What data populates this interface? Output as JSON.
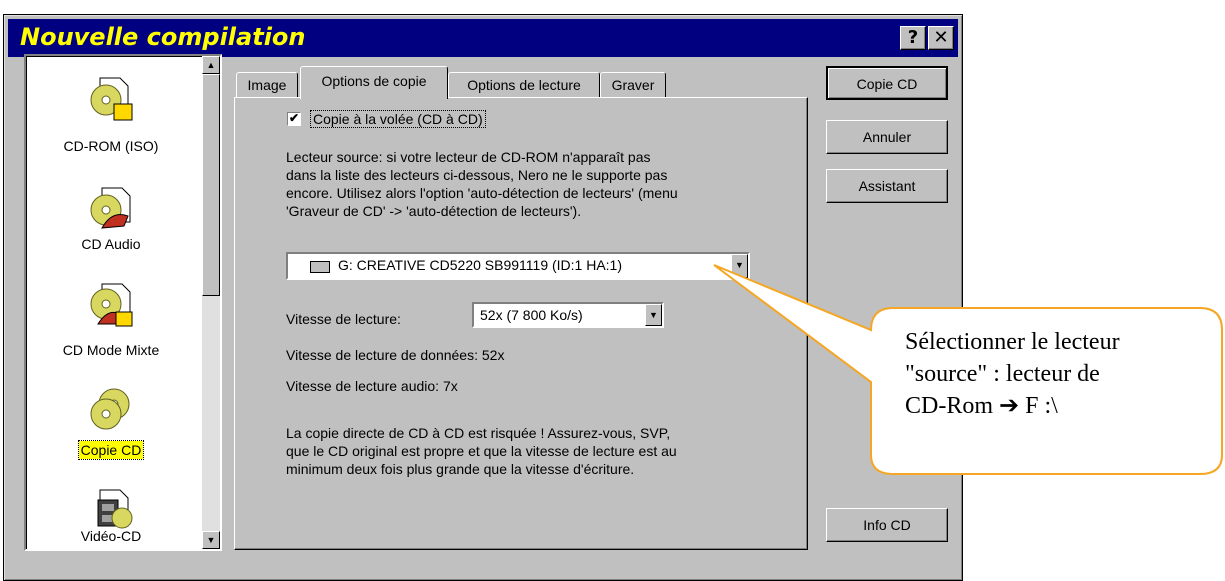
{
  "window": {
    "title": "Nouvelle compilation",
    "help_label": "?",
    "close_label": "✕"
  },
  "categories": [
    {
      "label": "CD-ROM (ISO)",
      "icon": "cd-rom-iso-icon"
    },
    {
      "label": "CD Audio",
      "icon": "cd-audio-icon"
    },
    {
      "label": "CD Mode Mixte",
      "icon": "cd-mixed-mode-icon"
    },
    {
      "label": "Copie CD",
      "icon": "copy-cd-icon",
      "selected": true
    },
    {
      "label": "Vidéo-CD",
      "icon": "video-cd-icon"
    }
  ],
  "tabs": [
    "Image",
    "Options de copie",
    "Options de lecture",
    "Graver"
  ],
  "active_tab": "Options de copie",
  "copy_options": {
    "on_the_fly_checked": true,
    "on_the_fly_check": "✔",
    "on_the_fly_label": "Copie à la volée (CD à CD)",
    "source_info_lines": [
      "Lecteur source: si votre lecteur de CD-ROM n'apparaît pas",
      "dans la liste des lecteurs ci-dessous, Nero ne le supporte pas",
      "encore. Utilisez alors l'option 'auto-détection de lecteurs' (menu",
      "'Graveur de CD' -> 'auto-détection de lecteurs')."
    ],
    "source_drive": "G: CREATIVE CD5220  SB991119 (ID:1  HA:1)",
    "read_speed_label": "Vitesse de lecture:",
    "read_speed_value": "52x (7 800 Ko/s)",
    "data_read_speed": "Vitesse de lecture de données: 52x",
    "audio_read_speed": "Vitesse de lecture audio: 7x",
    "warning_lines": [
      "La copie directe de CD à CD est risquée ! Assurez-vous, SVP,",
      "que le CD original est propre et que la vitesse de lecture est au",
      "minimum deux fois plus grande que la vitesse d'écriture."
    ]
  },
  "buttons": {
    "copy_cd": "Copie CD",
    "cancel": "Annuler",
    "wizard": "Assistant",
    "info_cd": "Info CD"
  },
  "callout": {
    "lines": [
      "Sélectionner le lecteur",
      "\"source\" : lecteur de",
      "CD-Rom ➔ F :\\"
    ]
  },
  "colors": {
    "titlebar": "#000080",
    "title_text": "#ffff00",
    "callout_border": "#f5a623",
    "dialog_face": "#c0c0c0"
  }
}
